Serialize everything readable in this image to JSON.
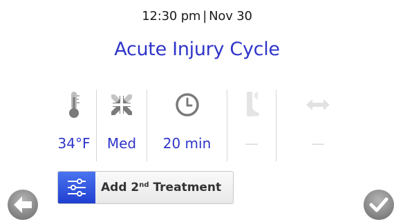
{
  "status": {
    "time": "12:30 pm",
    "separator": "|",
    "date": "Nov 30"
  },
  "title": "Acute Injury Cycle",
  "settings": [
    {
      "icon": "thermometer-icon",
      "value": "34°F",
      "active": true
    },
    {
      "icon": "compression-icon",
      "value": "Med",
      "active": true
    },
    {
      "icon": "clock-icon",
      "value": "20 min",
      "active": true
    },
    {
      "icon": "leg-icon",
      "value": "—",
      "active": false
    },
    {
      "icon": "horizontal-arrows-icon",
      "value": "—",
      "active": false
    }
  ],
  "add_treatment": {
    "icon": "sliders-icon",
    "label_prefix": "Add 2",
    "label_sup": "nd",
    "label_suffix": " Treatment"
  },
  "nav": {
    "back_icon": "back-arrow-icon",
    "confirm_icon": "checkmark-icon"
  },
  "colors": {
    "accent": "#2f35c8",
    "button_blue": "#2b4fe0",
    "disabled": "#d8d8d8",
    "nav_gray": "#8c8c8c"
  }
}
